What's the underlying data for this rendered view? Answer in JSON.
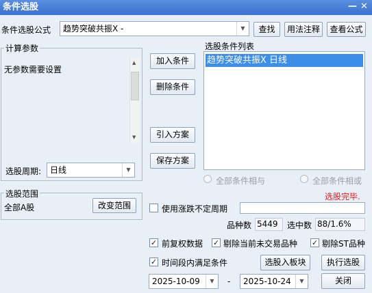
{
  "window": {
    "title": "条件选股"
  },
  "formula": {
    "label": "条件选股公式",
    "value": "趋势突破共振X  -",
    "find_btn": "查找",
    "usage_btn": "用法注释",
    "view_btn": "查看公式"
  },
  "params": {
    "group_title": "计算参数",
    "text": "无参数需要设置",
    "period_label": "选股周期:",
    "period_value": "日线"
  },
  "actions": {
    "add": "加入条件",
    "delete": "删除条件",
    "import": "引入方案",
    "save": "保存方案"
  },
  "conditions": {
    "title": "选股条件列表",
    "items": [
      "趋势突破共振X  日线"
    ],
    "all_and": "全部条件相与",
    "all_or": "全部条件相或",
    "status": "选股完毕."
  },
  "scope": {
    "group_title": "选股范围",
    "value": "全部A股",
    "change_btn": "改变范围"
  },
  "options": {
    "use_period_label": "使用涨跌不定周期",
    "count_label": "品种数",
    "count_value": "5449",
    "selected_label": "选中数",
    "selected_value": "88/1.6%",
    "prev_adjust": "前复权数据",
    "exclude_untraded": "剔除当前未交易品种",
    "exclude_st": "剔除ST品种",
    "time_range": "时间段内满足条件",
    "to_block_btn": "选股入板块",
    "run_btn": "执行选股",
    "close_btn": "关闭",
    "date_from": "2025-10-09",
    "date_to": "2025-10-24",
    "dash": "-"
  },
  "colors": {
    "titlebar": "#3a72d2",
    "selection": "#3d8ee8",
    "status": "#e02020"
  }
}
